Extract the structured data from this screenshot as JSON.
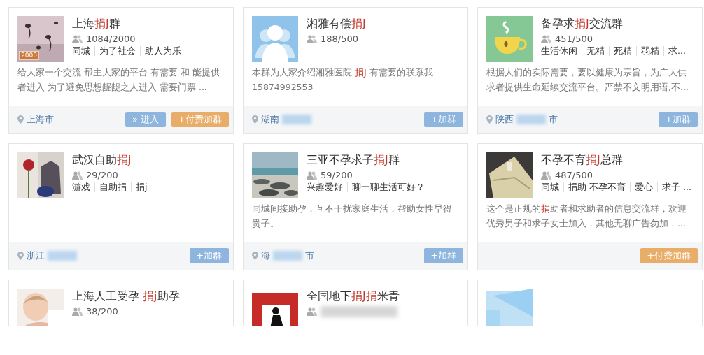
{
  "cards": [
    {
      "title": {
        "before": "上海",
        "highlight": "捐J",
        "after": "群"
      },
      "image": {
        "kind": "picture",
        "badge": "2000"
      },
      "count": "1084/2000",
      "tags": [
        "同城",
        "为了社会",
        "助人为乐"
      ],
      "description": {
        "before": "给大家一个交流 帮主大家的平台 有需要 和 能提供者进入  为了避免思想龌龊之人进入 需要门票 ..."
      },
      "location": {
        "text": "上海市"
      },
      "buttons": [
        {
          "kind": "enter",
          "label": "» 进入"
        },
        {
          "kind": "paid",
          "label": "+付费加群"
        }
      ]
    },
    {
      "title": {
        "before": "湘雅有偿",
        "highlight": "捐J"
      },
      "image": {
        "kind": "group-avatar"
      },
      "count": "188/500",
      "description": {
        "before": " 本群为大家介绍湘雅医院 ",
        "highlight": "捐J",
        "after": " 有需要的联系我15874992553"
      },
      "location": {
        "text": "湖南",
        "blurred": true
      },
      "buttons": [
        {
          "kind": "join",
          "label": "+加群"
        }
      ]
    },
    {
      "title": {
        "before": "备孕求",
        "highlight": "捐J",
        "after": "交流群"
      },
      "image": {
        "kind": "cup-logo"
      },
      "count": "451/500",
      "tags": [
        "生活休闲",
        "无精",
        "死精",
        "弱精",
        "求..."
      ],
      "description": {
        "before": "根据人们的实际需要，要以健康为宗旨，为广大供求者提供生命延续交流平台。严禁不文明用语,不..."
      },
      "location": {
        "text": "陕西",
        "blurred": true,
        "suffix": "市"
      },
      "buttons": [
        {
          "kind": "join",
          "label": "+加群"
        }
      ]
    },
    {
      "title": {
        "before": "武汉自助",
        "highlight": "捐j"
      },
      "image": {
        "kind": "picture"
      },
      "count": "29/200",
      "tags": [
        "游戏",
        "自助捐",
        "捐j"
      ],
      "location": {
        "text": "浙江",
        "blurred": true
      },
      "buttons": [
        {
          "kind": "join",
          "label": "+加群"
        }
      ]
    },
    {
      "title": {
        "before": "三亚不孕求子",
        "highlight": "捐J",
        "after": "群"
      },
      "image": {
        "kind": "picture"
      },
      "count": "59/200",
      "tags": [
        "兴趣爱好",
        "聊一聊生活可好？"
      ],
      "description": {
        "before": "同城间接助孕，互不干扰家庭生活，帮助女性早得贵子。"
      },
      "location": {
        "text": "海",
        "blurred": true,
        "suffix": "市"
      },
      "buttons": [
        {
          "kind": "join",
          "label": "+加群"
        }
      ]
    },
    {
      "title": {
        "before": "不孕不育",
        "highlight": "捐J",
        "after": "总群"
      },
      "image": {
        "kind": "picture"
      },
      "count": "487/500",
      "tags": [
        "同城",
        "捐助 不孕不育",
        "爱心",
        "求子 ..."
      ],
      "description": {
        "before": "这个是正规的",
        "highlight": "捐",
        "after": "助者和求助者的信息交流群，欢迎优秀男子和求子女士加入，其他无聊广告勿加，..."
      },
      "buttons": [
        {
          "kind": "paid",
          "label": "+付费加群"
        }
      ]
    },
    {
      "title": {
        "before": "上海人工受孕 ",
        "highlight": "捐j",
        "after": "助孕"
      },
      "image": {
        "kind": "picture"
      },
      "count": "38/200"
    },
    {
      "title": {
        "before": "全国地下",
        "highlight": "捐J捐",
        "after": "米青"
      },
      "image": {
        "kind": "picture"
      },
      "count_blurred": true
    },
    {
      "image": {
        "kind": "picture"
      }
    }
  ]
}
